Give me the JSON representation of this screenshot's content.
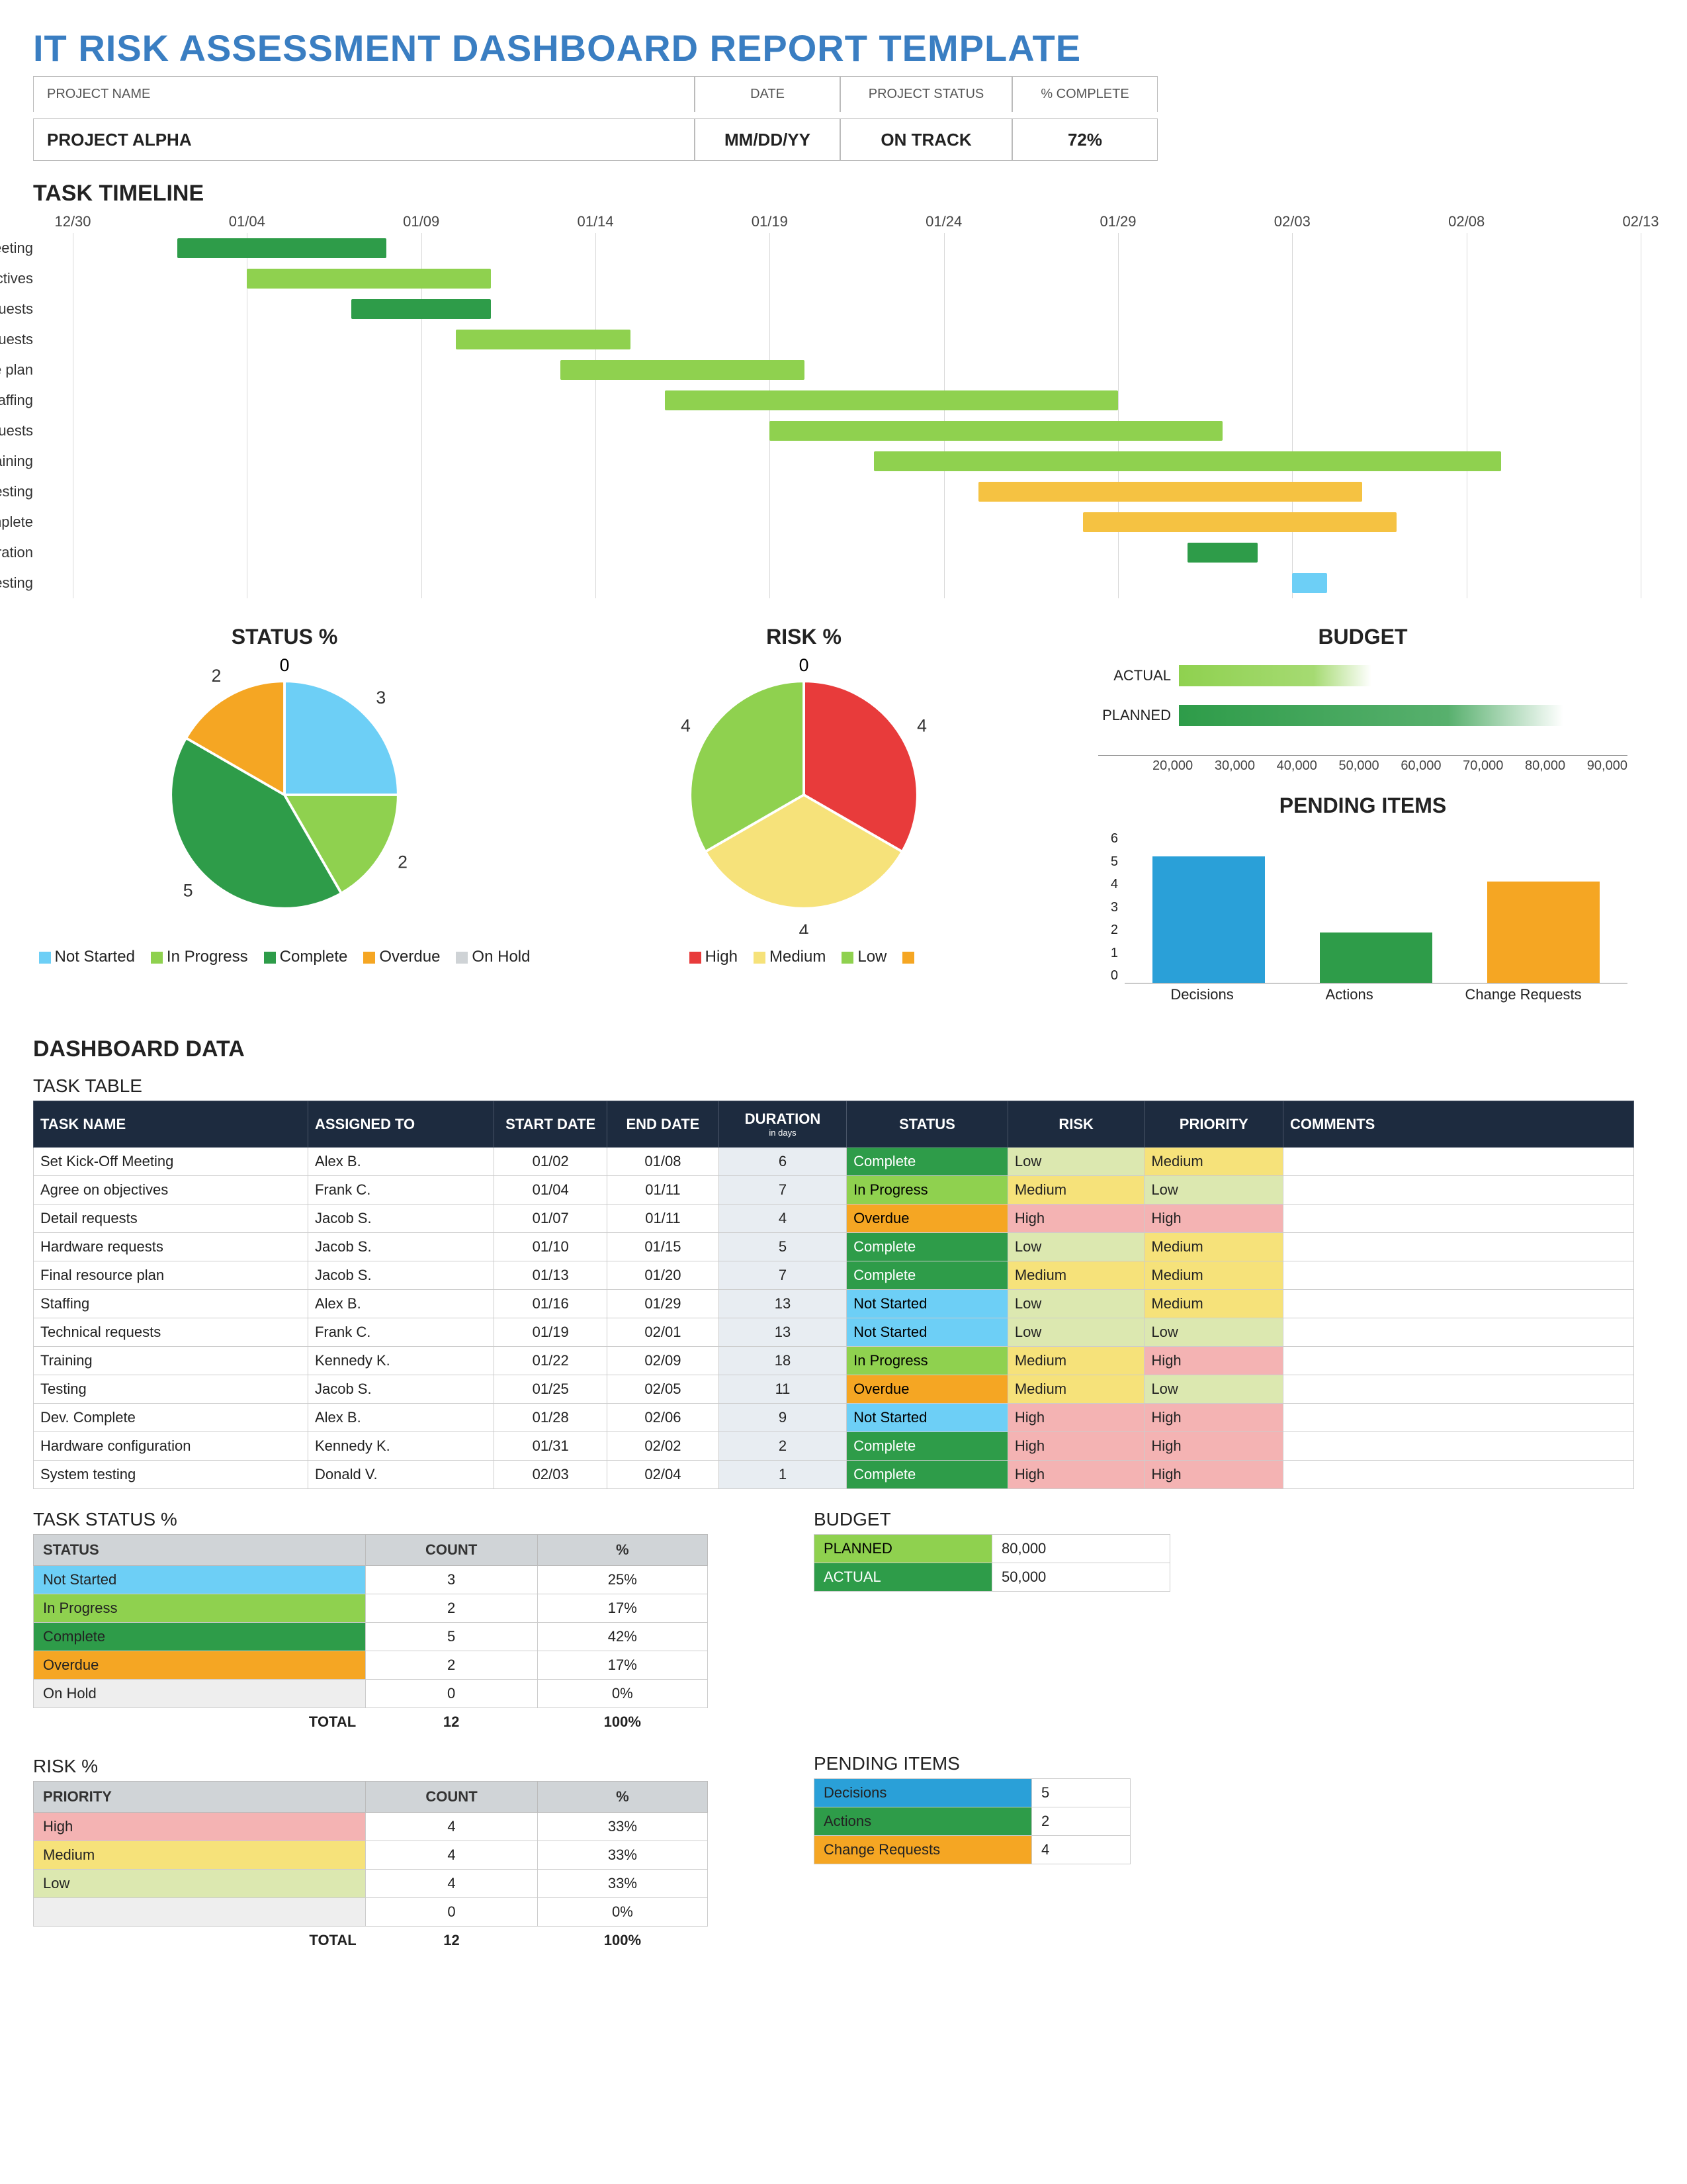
{
  "title": "IT RISK ASSESSMENT DASHBOARD REPORT TEMPLATE",
  "header": {
    "labels": {
      "project_name": "PROJECT NAME",
      "date": "DATE",
      "project_status": "PROJECT STATUS",
      "pct_complete": "% COMPLETE"
    },
    "values": {
      "project_name": "PROJECT ALPHA",
      "date": "MM/DD/YY",
      "project_status": "ON TRACK",
      "pct_complete": "72%"
    }
  },
  "sections": {
    "task_timeline": "TASK TIMELINE",
    "status_pct": "STATUS %",
    "risk_pct": "RISK %",
    "budget": "BUDGET",
    "pending": "PENDING ITEMS",
    "dashboard_data": "DASHBOARD DATA",
    "task_table": "TASK TABLE",
    "task_status_pct": "TASK STATUS %",
    "risk_pct_tbl": "RISK %",
    "budget_tbl": "BUDGET",
    "pending_tbl": "PENDING ITEMS"
  },
  "colors": {
    "complete": "#2e9c49",
    "in_progress": "#8fd14f",
    "not_started": "#6dcff6",
    "overdue": "#f5a623",
    "on_hold": "#cfd3d6",
    "high": "#e83b3b",
    "medium": "#f6e27a",
    "low": "#8fd14f",
    "status_cell": {
      "Complete": "#2e9c49",
      "In Progress": "#8fd14f",
      "Not Started": "#6dcff6",
      "Overdue": "#f5a623"
    },
    "risk_cell": {
      "Low": "#dce8b0",
      "Medium": "#f6e27a",
      "High": "#f4b3b3"
    },
    "priority_cell": {
      "Low": "#dce8b0",
      "Medium": "#f6e27a",
      "High": "#f4b3b3"
    },
    "pending": {
      "Decisions": "#2aa0d8",
      "Actions": "#2e9c49",
      "Change Requests": "#f5a623"
    }
  },
  "chart_data": [
    {
      "id": "timeline",
      "type": "gantt",
      "title": "TASK TIMELINE",
      "x_ticks": [
        "12/30",
        "01/04",
        "01/09",
        "01/14",
        "01/19",
        "01/24",
        "01/29",
        "02/03",
        "02/08",
        "02/13"
      ],
      "range": [
        "12/30",
        "02/13"
      ],
      "tasks": [
        {
          "name": "Set Kick-Off Meeting",
          "start": "01/02",
          "end": "01/08",
          "status": "Complete"
        },
        {
          "name": "Agree on objectives",
          "start": "01/04",
          "end": "01/11",
          "status": "In Progress"
        },
        {
          "name": "Detail requests",
          "start": "01/07",
          "end": "01/11",
          "status": "Overdue"
        },
        {
          "name": "Hardware requests",
          "start": "01/10",
          "end": "01/15",
          "status": "Complete"
        },
        {
          "name": "Final resource plan",
          "start": "01/13",
          "end": "01/20",
          "status": "Complete"
        },
        {
          "name": "Staffing",
          "start": "01/16",
          "end": "01/29",
          "status": "Not Started"
        },
        {
          "name": "Technical requests",
          "start": "01/19",
          "end": "02/01",
          "status": "Not Started"
        },
        {
          "name": "Training",
          "start": "01/22",
          "end": "02/09",
          "status": "In Progress"
        },
        {
          "name": "Testing",
          "start": "01/25",
          "end": "02/05",
          "status": "Overdue"
        },
        {
          "name": "Dev. Complete",
          "start": "01/28",
          "end": "02/06",
          "status": "Not Started"
        },
        {
          "name": "Hardware configuration",
          "start": "01/31",
          "end": "02/02",
          "status": "Complete"
        },
        {
          "name": "System testing",
          "start": "02/03",
          "end": "02/04",
          "status": "Complete"
        }
      ]
    },
    {
      "id": "status_pie",
      "type": "pie",
      "title": "STATUS %",
      "series": [
        {
          "name": "Status",
          "values": [
            {
              "label": "Not Started",
              "value": 3,
              "color": "#6dcff6"
            },
            {
              "label": "In Progress",
              "value": 2,
              "color": "#8fd14f"
            },
            {
              "label": "Complete",
              "value": 5,
              "color": "#2e9c49"
            },
            {
              "label": "Overdue",
              "value": 2,
              "color": "#f5a623"
            },
            {
              "label": "On Hold",
              "value": 0,
              "color": "#cfd3d6"
            }
          ]
        }
      ],
      "legend_order": [
        "Not Started",
        "In Progress",
        "Complete",
        "Overdue",
        "On Hold"
      ]
    },
    {
      "id": "risk_pie",
      "type": "pie",
      "title": "RISK %",
      "series": [
        {
          "name": "Risk",
          "values": [
            {
              "label": "High",
              "value": 4,
              "color": "#e83b3b"
            },
            {
              "label": "Medium",
              "value": 4,
              "color": "#f6e27a"
            },
            {
              "label": "Low",
              "value": 4,
              "color": "#8fd14f"
            },
            {
              "label": "",
              "value": 0,
              "color": "#f5a623"
            }
          ]
        }
      ],
      "legend_order": [
        "High",
        "Medium",
        "Low",
        ""
      ]
    },
    {
      "id": "budget_bar",
      "type": "bar",
      "orientation": "horizontal",
      "title": "BUDGET",
      "categories": [
        "ACTUAL",
        "PLANNED"
      ],
      "values": [
        50000,
        80000
      ],
      "colors": [
        "#8fd14f",
        "#2e9c49"
      ],
      "xticks": [
        20000,
        30000,
        40000,
        50000,
        60000,
        70000,
        80000,
        90000
      ],
      "xlim": [
        20000,
        90000
      ]
    },
    {
      "id": "pending_bar",
      "type": "bar",
      "title": "PENDING ITEMS",
      "categories": [
        "Decisions",
        "Actions",
        "Change Requests"
      ],
      "values": [
        5,
        2,
        4
      ],
      "colors": [
        "#2aa0d8",
        "#2e9c49",
        "#f5a623"
      ],
      "ylim": [
        0,
        6
      ],
      "yticks": [
        0,
        1,
        2,
        3,
        4,
        5,
        6
      ]
    }
  ],
  "task_table": {
    "headers": [
      "TASK NAME",
      "ASSIGNED TO",
      "START DATE",
      "END DATE",
      "DURATION",
      "STATUS",
      "RISK",
      "PRIORITY",
      "COMMENTS"
    ],
    "duration_sub": "in days",
    "rows": [
      [
        "Set Kick-Off Meeting",
        "Alex B.",
        "01/02",
        "01/08",
        "6",
        "Complete",
        "Low",
        "Medium",
        ""
      ],
      [
        "Agree on objectives",
        "Frank C.",
        "01/04",
        "01/11",
        "7",
        "In Progress",
        "Medium",
        "Low",
        ""
      ],
      [
        "Detail requests",
        "Jacob S.",
        "01/07",
        "01/11",
        "4",
        "Overdue",
        "High",
        "High",
        ""
      ],
      [
        "Hardware requests",
        "Jacob S.",
        "01/10",
        "01/15",
        "5",
        "Complete",
        "Low",
        "Medium",
        ""
      ],
      [
        "Final resource plan",
        "Jacob S.",
        "01/13",
        "01/20",
        "7",
        "Complete",
        "Medium",
        "Medium",
        ""
      ],
      [
        "Staffing",
        "Alex B.",
        "01/16",
        "01/29",
        "13",
        "Not Started",
        "Low",
        "Medium",
        ""
      ],
      [
        "Technical requests",
        "Frank C.",
        "01/19",
        "02/01",
        "13",
        "Not Started",
        "Low",
        "Low",
        ""
      ],
      [
        "Training",
        "Kennedy K.",
        "01/22",
        "02/09",
        "18",
        "In Progress",
        "Medium",
        "High",
        ""
      ],
      [
        "Testing",
        "Jacob S.",
        "01/25",
        "02/05",
        "11",
        "Overdue",
        "Medium",
        "Low",
        ""
      ],
      [
        "Dev. Complete",
        "Alex B.",
        "01/28",
        "02/06",
        "9",
        "Not Started",
        "High",
        "High",
        ""
      ],
      [
        "Hardware configuration",
        "Kennedy K.",
        "01/31",
        "02/02",
        "2",
        "Complete",
        "High",
        "High",
        ""
      ],
      [
        "System testing",
        "Donald V.",
        "02/03",
        "02/04",
        "1",
        "Complete",
        "High",
        "High",
        ""
      ]
    ]
  },
  "status_table": {
    "headers": [
      "STATUS",
      "COUNT",
      "%"
    ],
    "rows": [
      [
        "Not Started",
        "3",
        "25%"
      ],
      [
        "In Progress",
        "2",
        "17%"
      ],
      [
        "Complete",
        "5",
        "42%"
      ],
      [
        "Overdue",
        "2",
        "17%"
      ],
      [
        "On Hold",
        "0",
        "0%"
      ]
    ],
    "total": [
      "TOTAL",
      "12",
      "100%"
    ]
  },
  "risk_table": {
    "headers": [
      "PRIORITY",
      "COUNT",
      "%"
    ],
    "rows": [
      [
        "High",
        "4",
        "33%"
      ],
      [
        "Medium",
        "4",
        "33%"
      ],
      [
        "Low",
        "4",
        "33%"
      ],
      [
        "",
        "0",
        "0%"
      ]
    ],
    "total": [
      "TOTAL",
      "12",
      "100%"
    ]
  },
  "budget_table": {
    "rows": [
      [
        "PLANNED",
        "80,000"
      ],
      [
        "ACTUAL",
        "50,000"
      ]
    ]
  },
  "pending_table": {
    "rows": [
      [
        "Decisions",
        "5"
      ],
      [
        "Actions",
        "2"
      ],
      [
        "Change Requests",
        "4"
      ]
    ]
  }
}
